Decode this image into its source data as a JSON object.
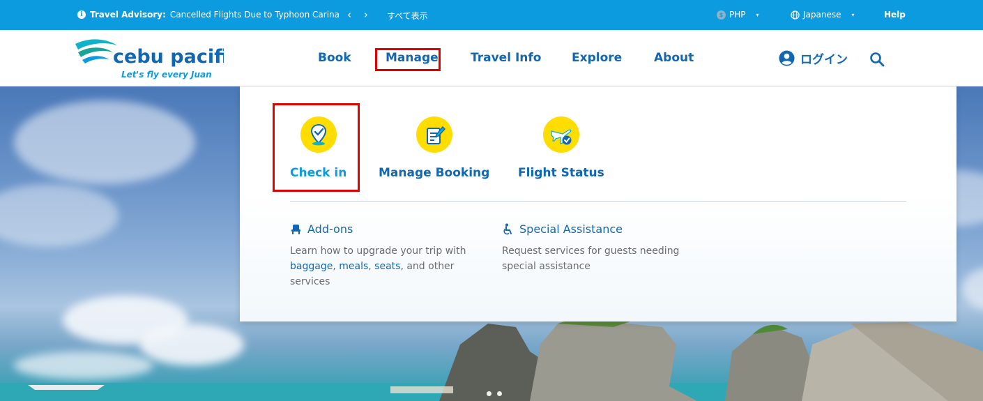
{
  "topbar": {
    "advisory_label": "Travel Advisory:",
    "advisory_text": "Cancelled Flights Due to Typhoon Carina",
    "prev_arrow": "‹",
    "next_arrow": "›",
    "show_all": "すべて表示",
    "currency": "PHP",
    "language": "Japanese",
    "help": "Help"
  },
  "header": {
    "logo_name": "cebu pacific",
    "logo_tagline": "Let's fly every Juan",
    "nav": [
      "Book",
      "Manage",
      "Travel Info",
      "Explore",
      "About"
    ],
    "login": "ログイン"
  },
  "dropdown": {
    "items": [
      {
        "label": "Check in",
        "icon": "check-in-location-icon"
      },
      {
        "label": "Manage Booking",
        "icon": "manage-booking-document-icon"
      },
      {
        "label": "Flight Status",
        "icon": "flight-status-plane-icon"
      }
    ],
    "addons": {
      "title": "Add-ons",
      "desc_prefix": "Learn how to upgrade your trip with",
      "link_baggage": "baggage",
      "link_meals": "meals",
      "link_seats": "seats",
      "desc_suffix": "and other services"
    },
    "assistance": {
      "title": "Special Assistance",
      "desc": "Request services for guests needing special assistance"
    }
  },
  "colors": {
    "topbar": "#0d9be0",
    "brand_blue": "#1167b1",
    "icon_yellow": "#ffdd00",
    "highlight_red": "#e00000"
  }
}
